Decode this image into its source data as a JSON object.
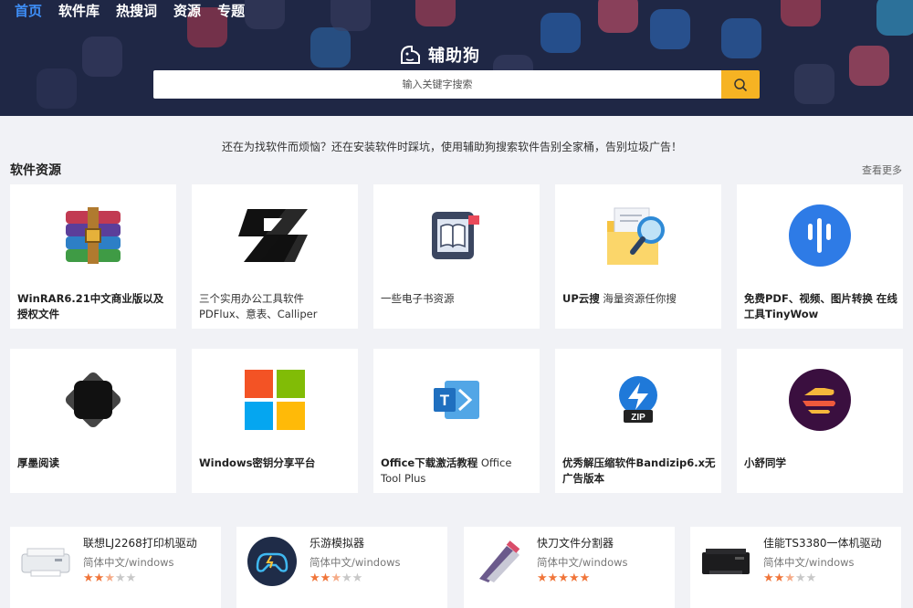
{
  "nav": {
    "items": [
      "首页",
      "软件库",
      "热搜词",
      "资源",
      "专题"
    ]
  },
  "brand": {
    "name": "辅助狗"
  },
  "search": {
    "placeholder": "输入关键字搜索"
  },
  "tagline": "还在为找软件而烦恼？还在安装软件时踩坑，使用辅助狗搜索软件告别全家桶，告别垃圾广告！",
  "section": {
    "title": "软件资源",
    "more": "查看更多"
  },
  "resources": [
    {
      "title": "WinRAR6.21中文商业版以及授权文件",
      "desc": "",
      "icon": "winrar-icon"
    },
    {
      "title": "三个实用办公工具软件 PDFlux、意表、Calliper",
      "desc": "",
      "icon": "pdflux-icon"
    },
    {
      "title": "一些电子书资源",
      "desc": "",
      "icon": "ebook-icon"
    },
    {
      "title": "UP云搜",
      "desc": " 海量资源任你搜",
      "icon": "folder-search-icon"
    },
    {
      "title": "免费PDF、视频、图片转换 在线工具TinyWow",
      "desc": "",
      "icon": "tinywow-icon"
    },
    {
      "title": "厚墨阅读",
      "desc": "",
      "icon": "houmo-icon"
    },
    {
      "title": "Windows密钥分享平台",
      "desc": "",
      "icon": "windows-icon"
    },
    {
      "title": "Office下载激活教程",
      "desc": " Office Tool Plus",
      "icon": "office-tool-icon"
    },
    {
      "title": "优秀解压缩软件Bandizip6.x无广告版本",
      "desc": "",
      "icon": "bandizip-icon"
    },
    {
      "title": "小舒同学",
      "desc": "",
      "icon": "xiaoshu-icon"
    }
  ],
  "apps": [
    {
      "name": "联想LJ2268打印机驱动",
      "sub": "简体中文/windows",
      "rating": 2.5,
      "icon": "printer-icon"
    },
    {
      "name": "乐游模拟器",
      "sub": "简体中文/windows",
      "rating": 2.5,
      "icon": "gamepad-icon"
    },
    {
      "name": "快刀文件分割器",
      "sub": "简体中文/windows",
      "rating": 5,
      "icon": "knife-icon"
    },
    {
      "name": "佳能TS3380一体机驱动",
      "sub": "简体中文/windows",
      "rating": 2.5,
      "icon": "canon-printer-icon"
    }
  ],
  "colors": {
    "header": "#1f2745",
    "nav_active": "#3e8ef7",
    "search_button": "#f6b323",
    "star": "#f0753a"
  }
}
